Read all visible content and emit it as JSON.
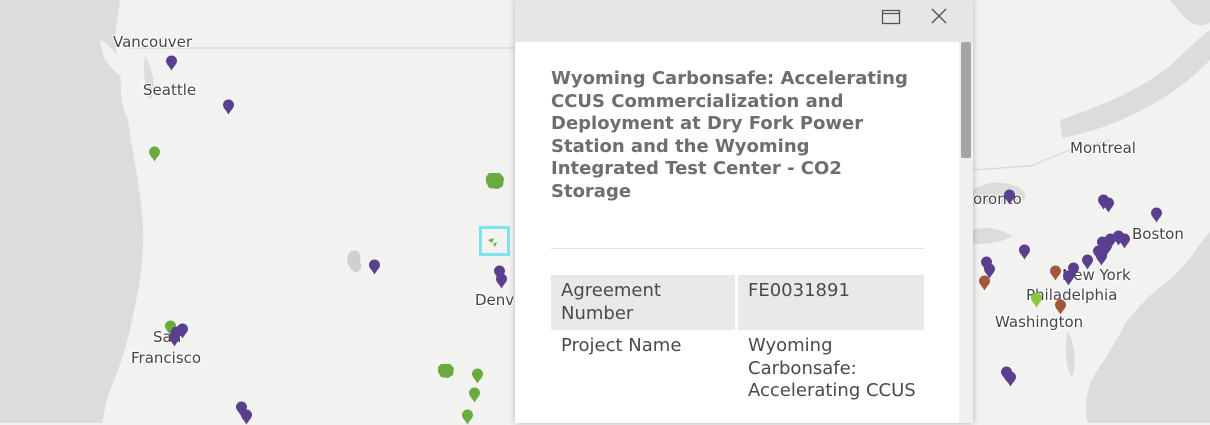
{
  "map": {
    "city_labels": {
      "vancouver": "Vancouver",
      "seattle": "Seattle",
      "san": "San",
      "francisco": "Francisco",
      "denver": "Denv",
      "montreal": "Montreal",
      "toronto": "oronto",
      "boston": "Boston",
      "new_york": "New York",
      "philadelphia": "Philadelphia",
      "washington": "Washington"
    },
    "pin_colors": {
      "purple": "#5b3f8f",
      "green": "#6aab3d",
      "brown": "#a1573a",
      "light_green": "#8cc63f"
    },
    "selection_color": "#7fe3ee"
  },
  "popup": {
    "title": "Wyoming Carbonsafe: Accelerating CCUS Commercialization and Deployment at Dry Fork Power Station and the Wyoming Integrated Test Center - CO2 Storage",
    "maximize_icon": "maximize-icon",
    "close_icon": "close-icon",
    "attributes": [
      {
        "key": "Agreement Number",
        "value": "FE0031891"
      },
      {
        "key": "Project Name",
        "value": "Wyoming Carbonsafe: Accelerating CCUS"
      }
    ]
  }
}
